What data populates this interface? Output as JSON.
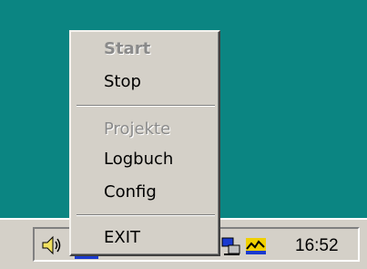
{
  "menu": {
    "items": [
      {
        "label": "Start",
        "enabled": false,
        "default": true
      },
      {
        "label": "Stop",
        "enabled": true
      },
      {
        "label": "Projekte",
        "enabled": false
      },
      {
        "label": "Logbuch",
        "enabled": true
      },
      {
        "label": "Config",
        "enabled": true
      },
      {
        "label": "EXIT",
        "enabled": true
      }
    ]
  },
  "taskbar": {
    "clock": "16:52",
    "tray_icons": [
      "speaker-icon",
      "app-icon",
      "network-icon",
      "app-icon"
    ]
  },
  "colors": {
    "desktop": "#008080",
    "menu_bg": "#d4d0c8",
    "disabled_text": "#8a8a8a"
  }
}
